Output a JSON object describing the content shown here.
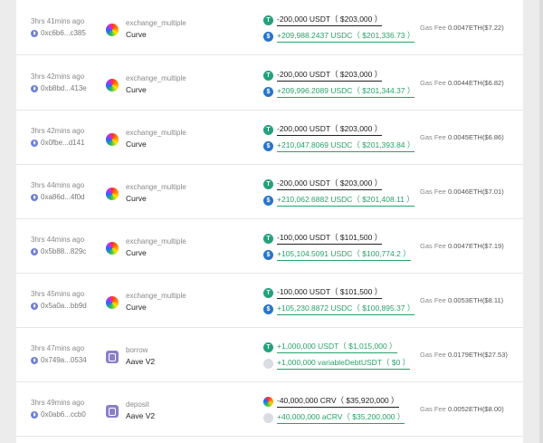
{
  "gas_label": "Gas Fee",
  "rows": [
    {
      "time": "3hrs 41mins ago",
      "hash": "0xc6b6...c385",
      "icon": "curve-logo-icon",
      "method": "exchange_multiple",
      "protocol": "Curve",
      "t1": {
        "icon": "usdt-icon",
        "amount": "-200,000 USDT（ $203,000 ）"
      },
      "t2": {
        "icon": "usdc-icon",
        "amount": "+209,988.2437 USDC（ $201,336.73 ）"
      },
      "gas": "0.0047ETH($7.22)"
    },
    {
      "time": "3hrs 42mins ago",
      "hash": "0xb8bd...413e",
      "icon": "curve-logo-icon",
      "method": "exchange_multiple",
      "protocol": "Curve",
      "t1": {
        "icon": "usdt-icon",
        "amount": "-200,000 USDT（ $203,000 ）"
      },
      "t2": {
        "icon": "usdc-icon",
        "amount": "+209,996.2089 USDC（ $201,344.37 ）"
      },
      "gas": "0.0044ETH($6.82)"
    },
    {
      "time": "3hrs 42mins ago",
      "hash": "0x0fbe...d141",
      "icon": "curve-logo-icon",
      "method": "exchange_multiple",
      "protocol": "Curve",
      "t1": {
        "icon": "usdt-icon",
        "amount": "-200,000 USDT（ $203,000 ）"
      },
      "t2": {
        "icon": "usdc-icon",
        "amount": "+210,047.8069 USDC（ $201,393.84 ）"
      },
      "gas": "0.0045ETH($6.86)"
    },
    {
      "time": "3hrs 44mins ago",
      "hash": "0xa86d...4f0d",
      "icon": "curve-logo-icon",
      "method": "exchange_multiple",
      "protocol": "Curve",
      "t1": {
        "icon": "usdt-icon",
        "amount": "-200,000 USDT（ $203,000 ）"
      },
      "t2": {
        "icon": "usdc-icon",
        "amount": "+210,062.6882 USDC（ $201,408.11 ）"
      },
      "gas": "0.0046ETH($7.01)"
    },
    {
      "time": "3hrs 44mins ago",
      "hash": "0x5b88...829c",
      "icon": "curve-logo-icon",
      "method": "exchange_multiple",
      "protocol": "Curve",
      "t1": {
        "icon": "usdt-icon",
        "amount": "-100,000 USDT（ $101,500 ）"
      },
      "t2": {
        "icon": "usdc-icon",
        "amount": "+105,104.5091 USDC（ $100,774.2 ）"
      },
      "gas": "0.0047ETH($7.19)"
    },
    {
      "time": "3hrs 45mins ago",
      "hash": "0x5a0a...bb9d",
      "icon": "curve-logo-icon",
      "method": "exchange_multiple",
      "protocol": "Curve",
      "t1": {
        "icon": "usdt-icon",
        "amount": "-100,000 USDT（ $101,500 ）"
      },
      "t2": {
        "icon": "usdc-icon",
        "amount": "+105,230.8872 USDC（ $100,895.37 ）"
      },
      "gas": "0.0053ETH($8.11)"
    },
    {
      "time": "3hrs 47mins ago",
      "hash": "0x749a...0534",
      "icon": "aave-logo-icon",
      "method": "borrow",
      "protocol": "Aave V2",
      "t1": {
        "icon": "usdt-icon",
        "amount": "+1,000,000 USDT（ $1,015,000 ）"
      },
      "t2": {
        "icon": "variable-debt-icon",
        "amount": "+1,000,000 variableDebtUSDT（ $0 ）"
      },
      "gas": "0.0179ETH($27.53)"
    },
    {
      "time": "3hrs 49mins ago",
      "hash": "0x0ab6...ccb0",
      "icon": "aave-logo-icon",
      "method": "deposit",
      "protocol": "Aave V2",
      "t1": {
        "icon": "crv-icon",
        "amount": "-40,000,000 CRV（ $35,920,000 ）"
      },
      "t2": {
        "icon": "acrv-icon",
        "amount": "+40,000,000 aCRV（ $35,200,000 ）"
      },
      "gas": "0.0052ETH($8.00)"
    }
  ]
}
